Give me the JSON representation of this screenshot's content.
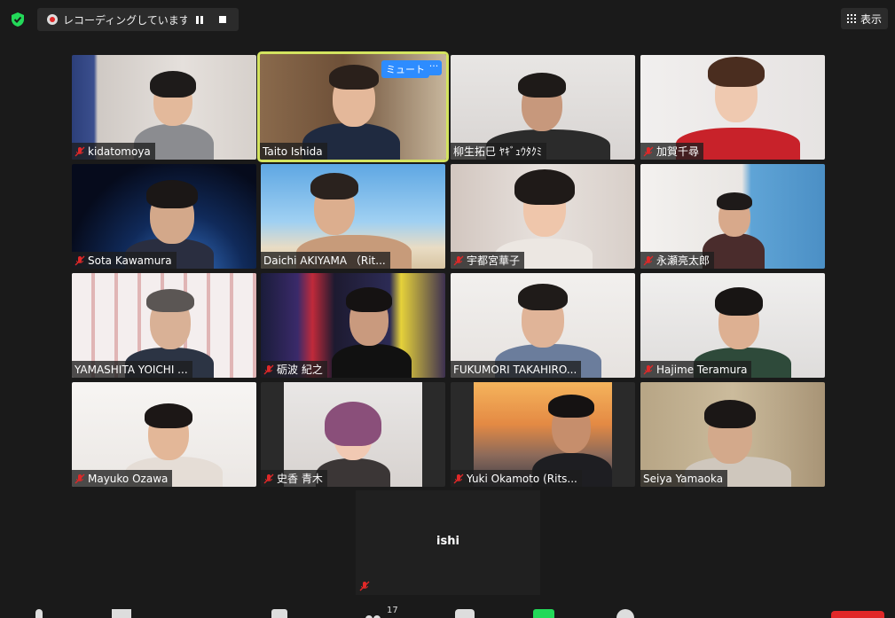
{
  "recording": {
    "text": "レコーディングしています..."
  },
  "view": {
    "label": "表示"
  },
  "active_tile": {
    "mute_label": "ミュート",
    "more_label": "···"
  },
  "participants": [
    {
      "name": "kidatomoya"
    },
    {
      "name": "Taito Ishida"
    },
    {
      "name": "柳生拓巳 ﾔｷﾞｭｳﾀｸﾐ"
    },
    {
      "name": "加賀千尋"
    },
    {
      "name": "Sota Kawamura"
    },
    {
      "name": "Daichi AKIYAMA （Rit..."
    },
    {
      "name": "宇都宮華子"
    },
    {
      "name": "永瀬亮太郎"
    },
    {
      "name": "YAMASHITA YOICHI ..."
    },
    {
      "name": "砺波 紀之"
    },
    {
      "name": "FUKUMORI TAKAHIRO..."
    },
    {
      "name": "Hajime Teramura"
    },
    {
      "name": "Mayuko Ozawa"
    },
    {
      "name": "史香 青木"
    },
    {
      "name": "Yuki Okamoto (Rits..."
    },
    {
      "name": "Seiya Yamaoka"
    }
  ],
  "ishi_tile": {
    "name": "ishi"
  },
  "toolbar": {
    "participant_count": "17"
  },
  "colors": {
    "active_border": "#d3e35f",
    "accent": "#2d8cff",
    "muted_mic": "#e02828"
  }
}
